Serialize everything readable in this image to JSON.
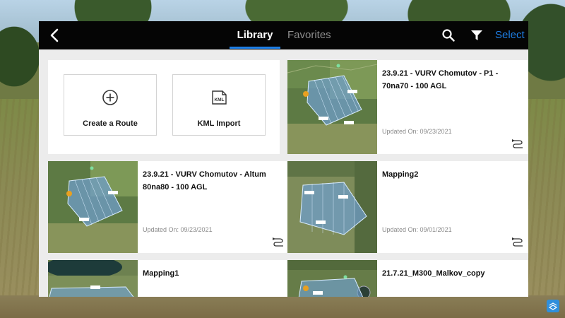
{
  "header": {
    "tabs": [
      {
        "label": "Library",
        "active": true
      },
      {
        "label": "Favorites",
        "active": false
      }
    ],
    "select_label": "Select"
  },
  "colors": {
    "accent": "#1e7fe6",
    "topbar": "#050505",
    "panel": "#ececec"
  },
  "actions": {
    "create_label": "Create a Route",
    "kml_label": "KML Import",
    "kml_icon_text": "KML"
  },
  "routes": [
    {
      "name": "23.9.21 - VURV Chomutov - P1 - 70na70 - 100 AGL",
      "date": "Updated On: 09/23/2021"
    },
    {
      "name": "23.9.21 - VURV Chomutov - Altum 80na80 - 100 AGL",
      "date": "Updated On: 09/23/2021"
    },
    {
      "name": "Mapping2",
      "date": "Updated On: 09/01/2021"
    },
    {
      "name": "Mapping1",
      "date": ""
    },
    {
      "name": "21.7.21_M300_Malkov_copy",
      "date": ""
    }
  ]
}
